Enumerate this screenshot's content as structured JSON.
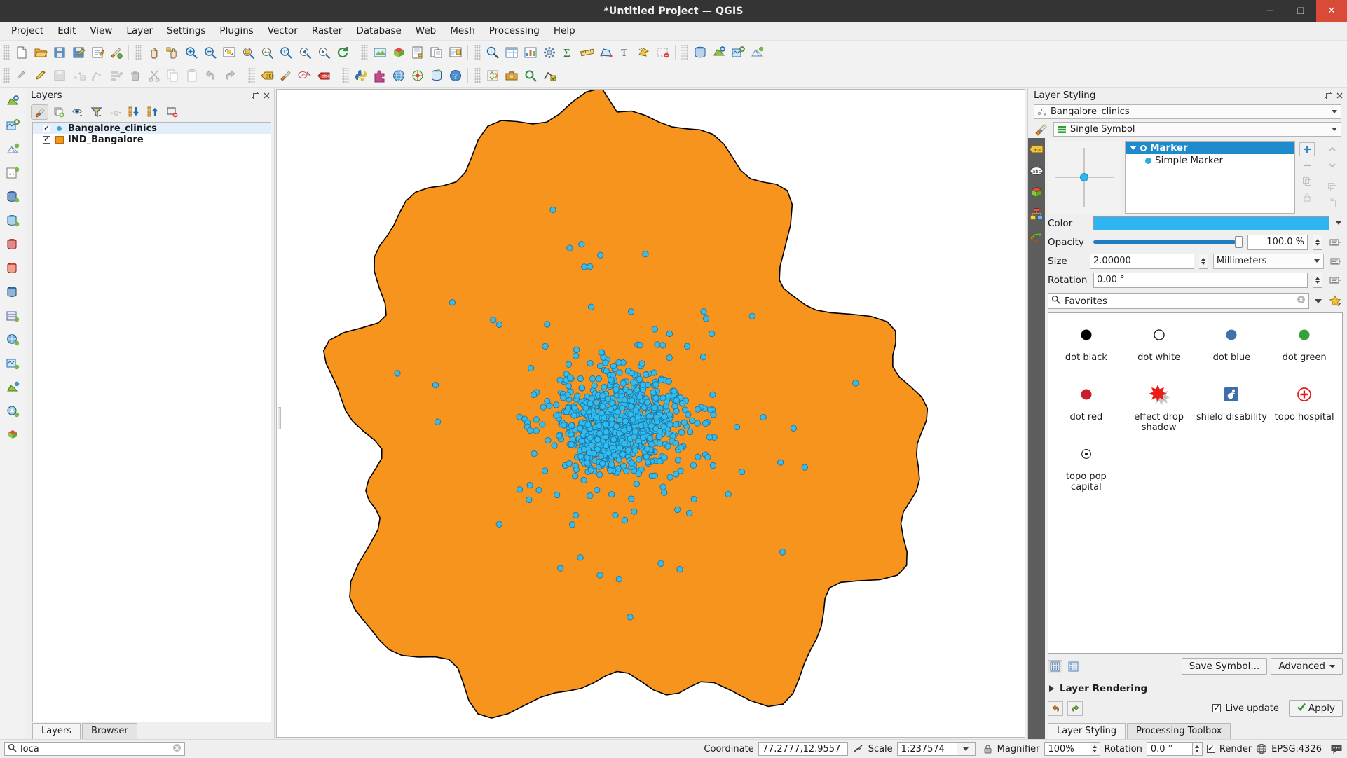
{
  "window": {
    "title": "*Untitled Project — QGIS",
    "minimize_label": "Minimize",
    "maximize_label": "Maximize",
    "close_label": "Close"
  },
  "menubar": {
    "items": [
      {
        "label": "Project"
      },
      {
        "label": "Edit"
      },
      {
        "label": "View"
      },
      {
        "label": "Layer"
      },
      {
        "label": "Settings"
      },
      {
        "label": "Plugins"
      },
      {
        "label": "Vector"
      },
      {
        "label": "Raster"
      },
      {
        "label": "Database"
      },
      {
        "label": "Web"
      },
      {
        "label": "Mesh"
      },
      {
        "label": "Processing"
      },
      {
        "label": "Help"
      }
    ]
  },
  "toolbar_main": {
    "icons": [
      "new-project-icon",
      "open-project-icon",
      "save-project-icon",
      "save-project-as-icon",
      "project-properties-icon",
      "style-manager-icon",
      "pan-map-icon",
      "pan-to-selection-icon",
      "zoom-in-icon",
      "zoom-out-icon",
      "zoom-full-icon",
      "zoom-to-selection-icon",
      "zoom-to-layer-icon",
      "zoom-native-icon",
      "zoom-last-icon",
      "zoom-next-icon",
      "refresh-icon",
      "new-map-view-icon",
      "new-3d-map-view-icon",
      "new-print-layout-icon",
      "layout-manager-icon",
      "show-layouts-icon",
      "identify-features-icon",
      "open-attribute-table-icon",
      "statistical-summary-icon",
      "options-icon",
      "sum-icon",
      "measure-line-icon",
      "measure-area-icon",
      "text-annotation-icon",
      "select-features-icon",
      "deselect-icon",
      "open-data-source-manager-icon",
      "add-vector-layer-icon",
      "add-raster-layer-icon",
      "add-mesh-layer-icon"
    ]
  },
  "toolbar_digitizing": {
    "icons": [
      "current-edits-icon",
      "toggle-editing-icon",
      "save-layer-edits-icon",
      "add-point-feature-icon",
      "vertex-tool-icon",
      "modify-attributes-icon",
      "delete-selected-icon",
      "cut-features-icon",
      "copy-features-icon",
      "paste-features-icon",
      "undo-icon",
      "redo-icon",
      "label-icon",
      "style-icon",
      "pin-labels-icon",
      "show-hide-labels-icon",
      "python-console-icon",
      "plugin-manager-icon",
      "browser-icon",
      "georeferencer-icon",
      "db-manager-icon",
      "help-icon",
      "processing-toolbox-icon",
      "toolbox-icon",
      "search-icon",
      "geometry-check-icon"
    ]
  },
  "left_rail": {
    "icons": [
      "add-vector-layer-icon",
      "add-raster-layer-icon",
      "add-mesh-layer-icon",
      "add-delimited-text-icon",
      "add-postgis-layer-icon",
      "add-spatialite-layer-icon",
      "add-mssql-layer-icon",
      "add-oracle-layer-icon",
      "add-db2-layer-icon",
      "add-virtual-layer-icon",
      "add-wms-layer-icon",
      "add-wcs-layer-icon",
      "add-wfs-layer-icon",
      "add-afs-layer-icon",
      "add-3d-tiles-icon"
    ]
  },
  "layers_panel": {
    "title": "Layers",
    "float_label": "Float panel",
    "close_label": "Close panel",
    "toolbar_icons": [
      "open-layer-styling-icon",
      "add-group-icon",
      "manage-visibility-icon",
      "filter-legend-icon",
      "filter-legend-expression-icon",
      "expand-all-icon",
      "collapse-all-icon",
      "remove-layer-icon"
    ],
    "layers": [
      {
        "name": "Bangalore_clinics",
        "checked": true,
        "symbol": "point-blue",
        "selected": true
      },
      {
        "name": "IND_Bangalore",
        "checked": true,
        "symbol": "polygon-orange",
        "selected": false
      }
    ],
    "tabs": [
      {
        "label": "Layers",
        "active": true
      },
      {
        "label": "Browser",
        "active": false
      }
    ]
  },
  "map": {
    "polygon_fill": "#F7941E",
    "polygon_stroke": "#000000",
    "point_fill": "#31BEEF",
    "point_stroke": "#1a73a8"
  },
  "style_panel": {
    "title": "Layer Styling",
    "layer_combo": "Bangalore_clinics",
    "layer_combo_icon": "point-layer-icon",
    "renderer_combo": "Single Symbol",
    "renderer_icon": "single-symbol-icon",
    "brush_icon": "symbology-icon",
    "vertical_tabs": [
      "symbology-icon",
      "labels-icon",
      "masks-icon",
      "3d-view-icon",
      "diagrams-icon",
      "actions-icon"
    ],
    "symbol_tree": [
      {
        "label": "Marker",
        "level": 0,
        "selected": true
      },
      {
        "label": "Simple Marker",
        "level": 1,
        "selected": false
      }
    ],
    "tree_buttons": [
      "add-symbol-layer-icon",
      "remove-symbol-layer-icon",
      "duplicate-symbol-layer-icon",
      "move-up-icon",
      "move-down-icon",
      "lock-colors-icon"
    ],
    "properties": {
      "color_label": "Color",
      "color_value": "#2CB5F0",
      "opacity_label": "Opacity",
      "opacity_value": "100.0 %",
      "size_label": "Size",
      "size_value": "2.00000",
      "size_unit": "Millimeters",
      "rotation_label": "Rotation",
      "rotation_value": "0.00 °"
    },
    "search": {
      "placeholder": "Favorites",
      "value": "Favorites",
      "icon": "search-icon",
      "clear_icon": "clear-icon",
      "dropdown_icon": "chevron-down-icon",
      "favorite_icon": "star-icon"
    },
    "gallery": [
      {
        "label": "dot  black",
        "icon": "dot-black"
      },
      {
        "label": "dot  white",
        "icon": "dot-white"
      },
      {
        "label": "dot blue",
        "icon": "dot-blue"
      },
      {
        "label": "dot green",
        "icon": "dot-green"
      },
      {
        "label": "dot red",
        "icon": "dot-red"
      },
      {
        "label": "effect drop shadow",
        "icon": "effect-drop-shadow"
      },
      {
        "label": "shield disability",
        "icon": "shield-disability"
      },
      {
        "label": "topo hospital",
        "icon": "topo-hospital"
      },
      {
        "label": "topo pop capital",
        "icon": "topo-pop-capital"
      }
    ],
    "gallery_view_icons": [
      "grid-view-icon",
      "list-view-icon"
    ],
    "save_symbol_label": "Save Symbol...",
    "advanced_label": "Advanced",
    "layer_rendering_label": "Layer Rendering",
    "undo_icon": "undo-icon",
    "redo_icon": "redo-icon",
    "live_update_label": "Live update",
    "live_update_checked": true,
    "apply_label": "Apply",
    "tabs": [
      {
        "label": "Layer Styling",
        "active": true
      },
      {
        "label": "Processing Toolbox",
        "active": false
      }
    ]
  },
  "statusbar": {
    "locator_value": "loca",
    "locator_icon": "search-icon",
    "locator_clear_icon": "clear-icon",
    "coordinate_label": "Coordinate",
    "coordinate_value": "77.2777,12.9557",
    "toggle_extents_icon": "toggle-extents-icon",
    "scale_label": "Scale",
    "scale_value": "1:237574",
    "lock_icon": "lock-icon",
    "magnifier_label": "Magnifier",
    "magnifier_value": "100%",
    "rotation_label": "Rotation",
    "rotation_value": "0.0 °",
    "render_label": "Render",
    "render_checked": true,
    "crs_label": "EPSG:4326",
    "crs_icon": "globe-icon",
    "messages_icon": "messages-icon"
  }
}
